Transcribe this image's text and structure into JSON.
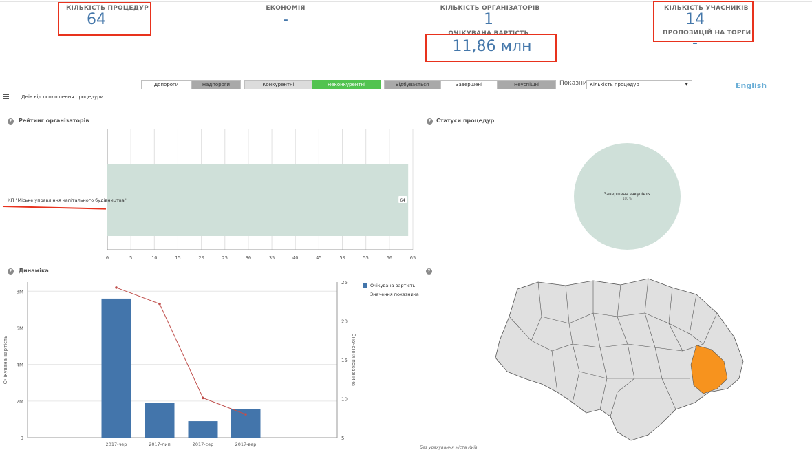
{
  "kpi": {
    "procedures_label": "КІЛЬКІСТЬ ПРОЦЕДУР",
    "procedures_value": "64",
    "economy_label": "ЕКОНОМІЯ",
    "economy_value": "-",
    "organizers_label": "КІЛЬКІСТЬ ОРГАНІЗАТОРІВ",
    "organizers_value": "1",
    "expected_label": "ОЧІКУВАНА ВАРТІСТЬ",
    "expected_value": "11,86 млн",
    "participants_label": "КІЛЬКІСТЬ УЧАСНИКІВ",
    "participants_value": "14",
    "proposals_label": "ПРОПОЗИЦІЙ НА ТОРГИ",
    "proposals_value": "-"
  },
  "filters": {
    "group1": [
      "Допороги",
      "Надпороги"
    ],
    "group2": [
      "Конкурентні",
      "Неконкурентні"
    ],
    "group3": [
      "Відбувається",
      "Завершені",
      "Неуспішні"
    ],
    "indicator_label": "Показник",
    "indicator_value": "Кількість процедур"
  },
  "lang": "English",
  "menu_label": "Днів від оголошення процедури",
  "rating": {
    "title": "Рейтинг організаторів",
    "org_name": "КП \"Міське управління капітального будівництва\""
  },
  "statuses": {
    "title": "Статуси процедур",
    "slice_label": "Завершена закупівля",
    "slice_pct": "100 %"
  },
  "dynamics": {
    "title": "Динаміка",
    "legend_bar": "Очікувана вартість",
    "legend_line": "Значення показника",
    "ylabel_left": "Очікувана вартість",
    "ylabel_right": "Значення показника"
  },
  "map": {
    "footer": "Без урахування міста Київ",
    "highlight_color": "#f7931e"
  },
  "colors": {
    "accent": "#4477aa",
    "bar_rating": "#cfe0d9",
    "bar_dyn": "#4375ab",
    "line_dyn": "#c0504d",
    "green": "#52c350",
    "red_box": "#e8321d"
  },
  "chart_data": [
    {
      "type": "bar",
      "orientation": "horizontal",
      "title": "Рейтинг організаторів",
      "categories": [
        "КП \"Міське управління капітального будівництва\""
      ],
      "values": [
        64
      ],
      "xlim": [
        0,
        65
      ],
      "xticks": [
        "0",
        "5",
        "10",
        "15",
        "20",
        "25",
        "30",
        "35",
        "40",
        "45",
        "50",
        "55",
        "60",
        "65"
      ],
      "value_label": "64"
    },
    {
      "type": "pie",
      "title": "Статуси процедур",
      "labels": [
        "Завершена закупівля"
      ],
      "values": [
        100
      ]
    },
    {
      "type": "bar",
      "title": "Динаміка",
      "categories": [
        "2017-чер",
        "2017-лип",
        "2017-сер",
        "2017-вер"
      ],
      "series": [
        {
          "name": "Очікувана вартість",
          "type": "bar",
          "axis": "left",
          "values": [
            7600000,
            1900000,
            900000,
            1550000
          ]
        },
        {
          "name": "Значення показника",
          "type": "line",
          "axis": "right",
          "values": [
            24.3,
            22.2,
            10.1,
            8.0
          ]
        }
      ],
      "ylim_left": [
        0,
        8500000
      ],
      "yticks_left": [
        "0",
        "2M",
        "4M",
        "6M",
        "8M"
      ],
      "ylim_right": [
        5,
        25
      ],
      "yticks_right": [
        "5",
        "10",
        "15",
        "20",
        "25"
      ]
    }
  ]
}
